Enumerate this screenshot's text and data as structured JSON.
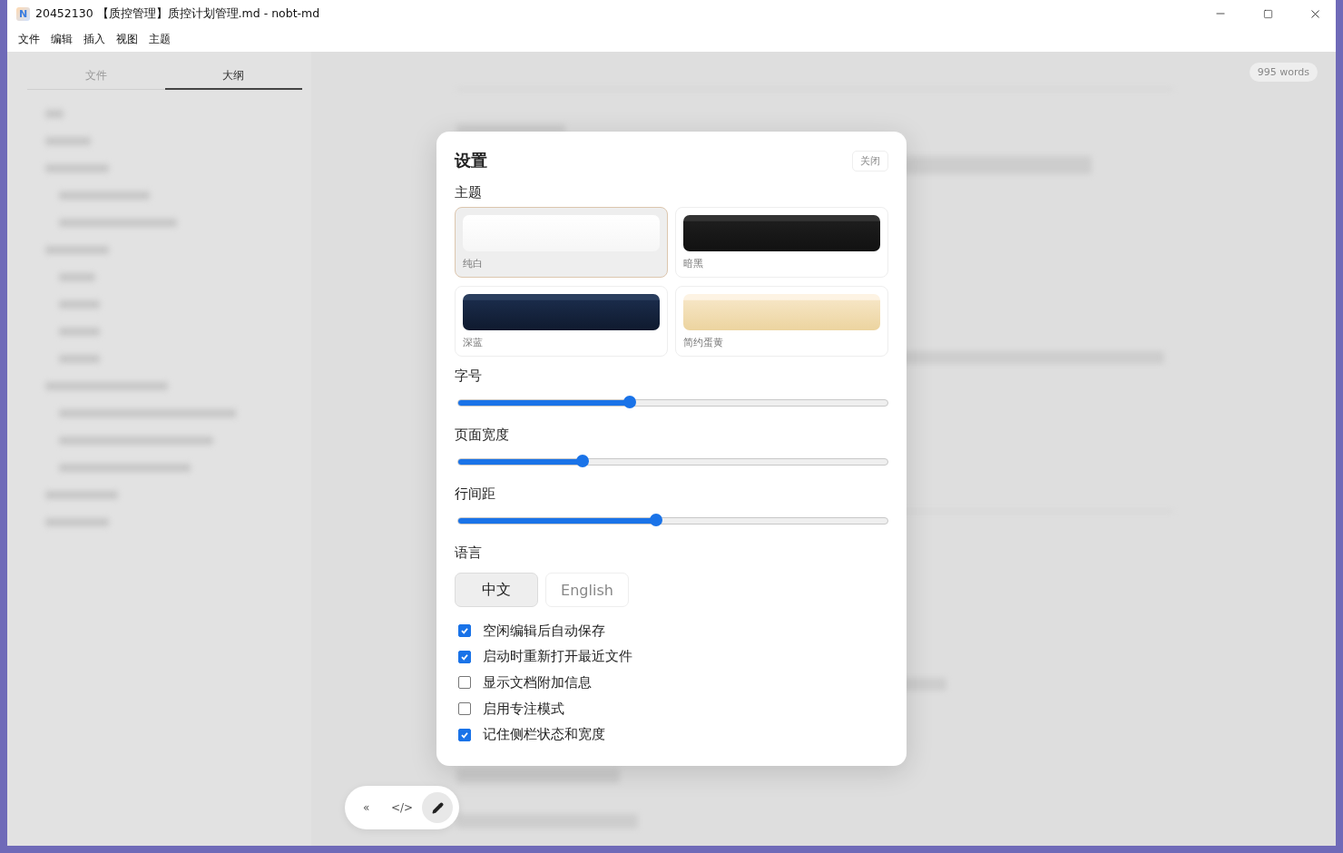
{
  "window": {
    "logo": "N",
    "title": "20452130 【质控管理】质控计划管理.md - nobt-md"
  },
  "menu": [
    "文件",
    "编辑",
    "插入",
    "视图",
    "主题"
  ],
  "sidebar": {
    "tabs": [
      {
        "label": "文件",
        "selected": false
      },
      {
        "label": "大纲",
        "selected": true
      }
    ]
  },
  "word_count": "995 words",
  "settings": {
    "title": "设置",
    "close": "关闭",
    "theme_label": "主题",
    "themes": [
      {
        "label": "纯白",
        "kind": "white",
        "selected": true
      },
      {
        "label": "暗黑",
        "kind": "dark",
        "selected": false
      },
      {
        "label": "深蓝",
        "kind": "navy",
        "selected": false
      },
      {
        "label": "简约蛋黄",
        "kind": "cream",
        "selected": false
      }
    ],
    "sliders": [
      {
        "label": "字号",
        "level": 0.4
      },
      {
        "label": "页面宽度",
        "level": 0.29
      },
      {
        "label": "行间距",
        "level": 0.46
      }
    ],
    "language_label": "语言",
    "languages": [
      {
        "label": "中文",
        "selected": true
      },
      {
        "label": "English",
        "selected": false
      }
    ],
    "options": [
      {
        "label": "空闲编辑后自动保存",
        "checked": true
      },
      {
        "label": "启动时重新打开最近文件",
        "checked": true
      },
      {
        "label": "显示文档附加信息",
        "checked": false
      },
      {
        "label": "启用专注模式",
        "checked": false
      },
      {
        "label": "记住侧栏状态和宽度",
        "checked": true
      }
    ]
  },
  "toolbar": [
    {
      "kind": "text",
      "label": "«",
      "selected": false
    },
    {
      "kind": "text",
      "label": "</>",
      "selected": false
    },
    {
      "kind": "pencil",
      "selected": true
    }
  ]
}
